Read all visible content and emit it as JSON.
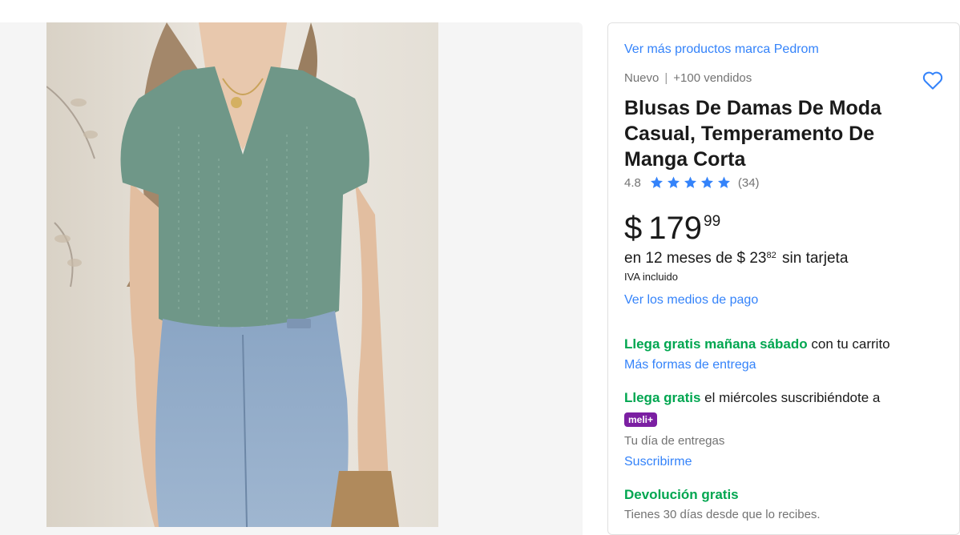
{
  "product": {
    "brand_link": "Ver más productos marca Pedrom",
    "condition": "Nuevo",
    "separator": "|",
    "sold": "+100 vendidos",
    "title": "Blusas De Damas De Moda Casual, Temperamento De Manga Corta",
    "rating": "4.8",
    "stars": 5,
    "reviews": "(34)",
    "star_color": "#3483fa"
  },
  "price": {
    "currency": "$",
    "integer": "179",
    "cents": "99",
    "installments_prefix": "en 12 meses de",
    "installment_currency": "$",
    "installment_integer": "23",
    "installment_cents": "82",
    "installments_suffix": "sin tarjeta",
    "tax_note": "IVA incluido",
    "payment_link": "Ver los medios de pago"
  },
  "shipping": {
    "free_tomorrow": "Llega gratis mañana sábado",
    "free_tomorrow_suffix": "con tu carrito",
    "more_options_link": "Más formas de entrega",
    "free_wed": "Llega gratis",
    "free_wed_suffix": "el miércoles suscribiéndote a",
    "meli_badge": "meli+",
    "delivery_day": "Tu día de entregas",
    "subscribe_link": "Suscribirme"
  },
  "returns": {
    "title": "Devolución gratis",
    "text": "Tienes 30 días desde que lo recibes."
  },
  "colors": {
    "accent": "#3483fa",
    "green": "#00a650",
    "meli_purple": "#7b1fa2"
  },
  "icons": {
    "favorite": "heart-icon",
    "rating": "star-icon"
  }
}
